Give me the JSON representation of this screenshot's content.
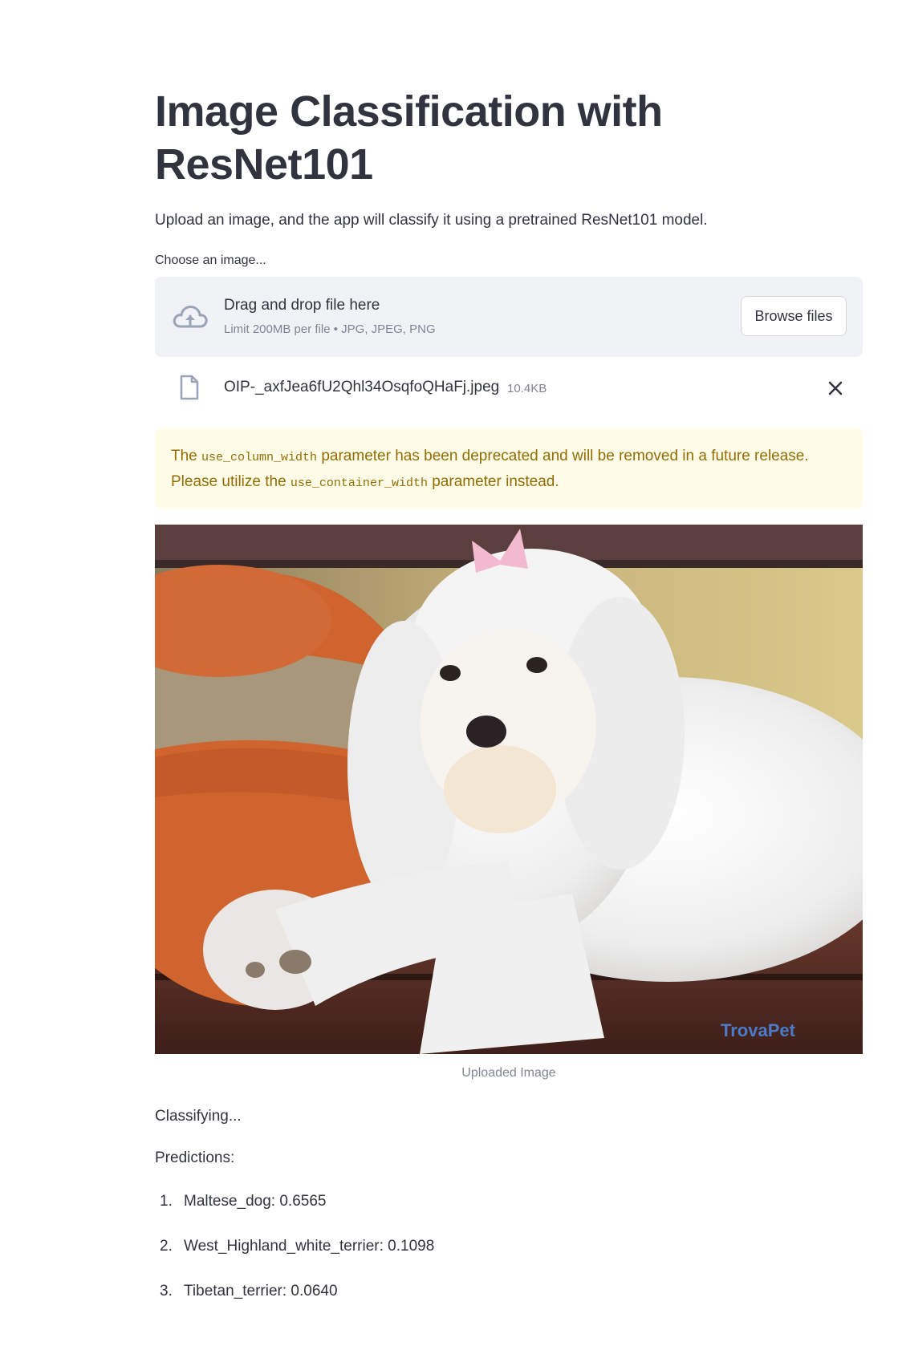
{
  "page": {
    "title": "Image Classification with ResNet101",
    "description": "Upload an image, and the app will classify it using a pretrained ResNet101 model."
  },
  "uploader": {
    "label": "Choose an image...",
    "drop_title": "Drag and drop file here",
    "limit_text": "Limit 200MB per file • JPG, JPEG, PNG",
    "browse_label": "Browse files",
    "icon": "cloud-upload-icon"
  },
  "uploaded_file": {
    "name": "OIP-_axfJea6fU2Qhl34OsqfoQHaFj.jpeg",
    "size": "10.4KB",
    "icon": "file-icon",
    "remove_icon": "close-icon"
  },
  "warning": {
    "part1": "The ",
    "code1": "use_column_width",
    "part2": " parameter has been deprecated and will be removed in a future release. Please utilize the ",
    "code2": "use_container_width",
    "part3": " parameter instead."
  },
  "image": {
    "caption": "Uploaded Image",
    "watermark": "TrovaPet"
  },
  "status": {
    "classifying": "Classifying..."
  },
  "predictions": {
    "heading": "Predictions:",
    "items": [
      {
        "num": "1.",
        "text": "Maltese_dog: 0.6565"
      },
      {
        "num": "2.",
        "text": "West_Highland_white_terrier: 0.1098"
      },
      {
        "num": "3.",
        "text": "Tibetan_terrier: 0.0640"
      }
    ]
  },
  "colors": {
    "text": "#31333f",
    "muted": "#808495",
    "dropzone_bg": "#f0f2f6",
    "warning_bg": "#fffce7",
    "warning_text": "#926c05"
  }
}
